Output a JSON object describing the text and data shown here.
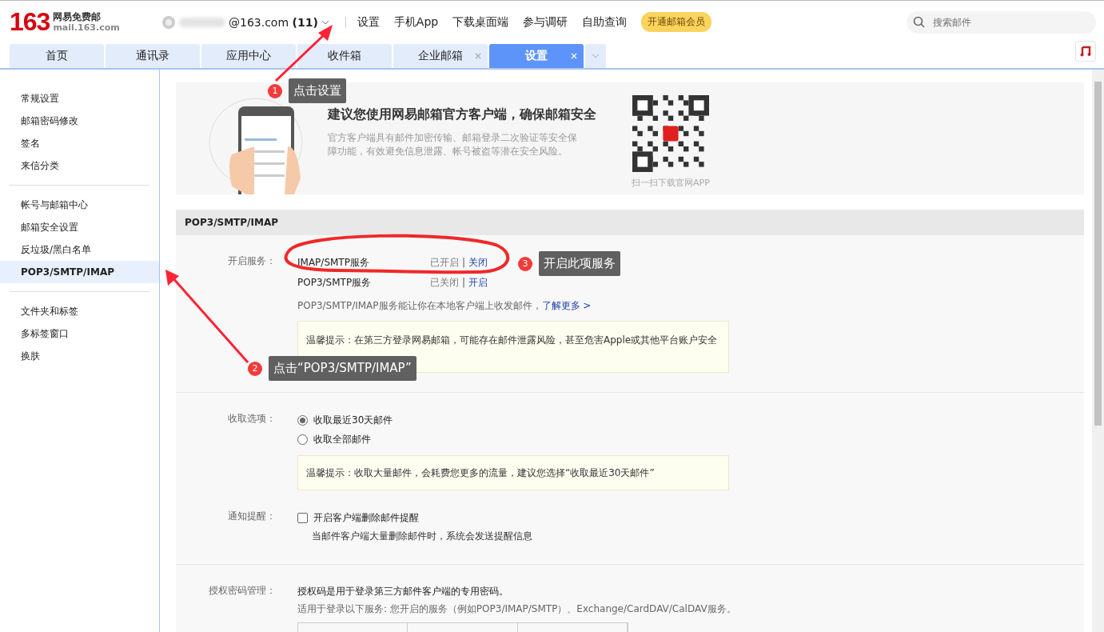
{
  "logo": {
    "number": "163",
    "name": "网易免费邮",
    "domain": "mail.163.com"
  },
  "account": {
    "email": "@163.com",
    "count": "(11)"
  },
  "top_links": [
    "设置",
    "手机App",
    "下载桌面端",
    "参与调研",
    "自助查询"
  ],
  "vip_button": "开通邮箱会员",
  "search": {
    "placeholder": "搜索邮件"
  },
  "tabs": [
    {
      "label": "首页",
      "selected": false,
      "closable": false
    },
    {
      "label": "通讯录",
      "selected": false,
      "closable": false
    },
    {
      "label": "应用中心",
      "selected": false,
      "closable": false
    },
    {
      "label": "收件箱",
      "selected": false,
      "closable": false
    },
    {
      "label": "企业邮箱",
      "selected": false,
      "closable": true
    },
    {
      "label": "设置",
      "selected": true,
      "closable": true
    }
  ],
  "sidebar": {
    "groups": [
      [
        {
          "label": "常规设置",
          "selected": false
        },
        {
          "label": "邮箱密码修改",
          "selected": false
        },
        {
          "label": "签名",
          "selected": false
        },
        {
          "label": "来信分类",
          "selected": false
        }
      ],
      [
        {
          "label": "帐号与邮箱中心",
          "selected": false
        },
        {
          "label": "邮箱安全设置",
          "selected": false
        },
        {
          "label": "反垃圾/黑白名单",
          "selected": false
        },
        {
          "label": "POP3/SMTP/IMAP",
          "selected": true
        }
      ],
      [
        {
          "label": "文件夹和标签",
          "selected": false
        },
        {
          "label": "多标签窗口",
          "selected": false
        },
        {
          "label": "换肤",
          "selected": false
        }
      ]
    ]
  },
  "banner": {
    "title": "建议您使用网易邮箱官方客户端，确保邮箱安全",
    "text": "官方客户端具有邮件加密传输、邮箱登录二次验证等安全保障功能，有效避免信息泄露、帐号被盗等潜在安全风险。",
    "qr_caption": "扫一扫下载官网APP"
  },
  "section_title": "POP3/SMTP/IMAP",
  "service_label": "开启服务：",
  "services": [
    {
      "name": "IMAP/SMTP服务",
      "status": "已开启",
      "separator": "|",
      "action": "关闭"
    },
    {
      "name": "POP3/SMTP服务",
      "status": "已关闭",
      "separator": "|",
      "action": "开启"
    }
  ],
  "service_note": "POP3/SMTP/IMAP服务能让你在本地客户端上收发邮件，",
  "learn_more": "了解更多 >",
  "service_tip": "温馨提示：在第三方登录网易邮箱，可能存在邮件泄露风险，甚至危害Apple或其他平台账户安全",
  "fetch": {
    "label": "收取选项：",
    "options": [
      {
        "label": "收取最近30天邮件",
        "selected": true
      },
      {
        "label": "收取全部邮件",
        "selected": false
      }
    ],
    "tip": "温馨提示：收取大量邮件，会耗费您更多的流量，建议您选择“收取最近30天邮件”"
  },
  "notify": {
    "label": "通知提醒：",
    "option": {
      "label": "开启客户端删除邮件提醒",
      "checked": false
    },
    "hint": "当邮件客户端大量删除邮件时，系统会发送提醒信息"
  },
  "auth": {
    "label": "授权密码管理：",
    "text": "授权码是用于登录第三方邮件客户端的专用密码。",
    "subtext": "适用于登录以下服务: 您开启的服务（例如POP3/IMAP/SMTP）、Exchange/CardDAV/CalDAV服务。"
  },
  "annotations": [
    {
      "number": "1",
      "text": "点击设置"
    },
    {
      "number": "2",
      "text": "点击“POP3/SMTP/IMAP”"
    },
    {
      "number": "3",
      "text": "开启此项服务"
    }
  ]
}
